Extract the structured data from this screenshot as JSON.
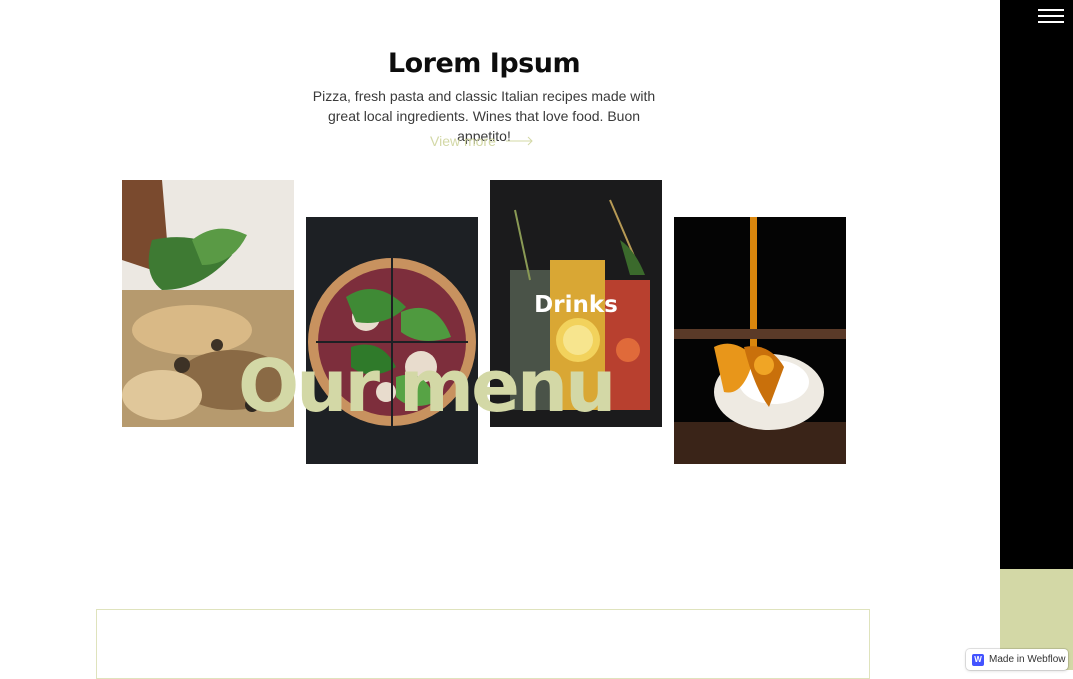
{
  "section": {
    "title": "Lorem Ipsum",
    "description": "Pizza, fresh pasta and classic Italian recipes made with great local ingredients. Wines that love food. Buon appetito!",
    "view_more_label": "View more"
  },
  "menu": {
    "heading": "Our menu",
    "cards": [
      {
        "label": "",
        "image": "pizza-closeup-photo"
      },
      {
        "label": "",
        "image": "arugula-pizza-photo"
      },
      {
        "label": "Drinks",
        "image": "cocktail-drinks-photo"
      },
      {
        "label": "",
        "image": "caramel-dessert-photo"
      }
    ]
  },
  "nav": {
    "menu_icon": "hamburger-icon"
  },
  "badge": {
    "label": "Made in Webflow",
    "logo_letter": "W"
  },
  "colors": {
    "accent": "#d3d8a6",
    "sidebar": "#000000"
  }
}
